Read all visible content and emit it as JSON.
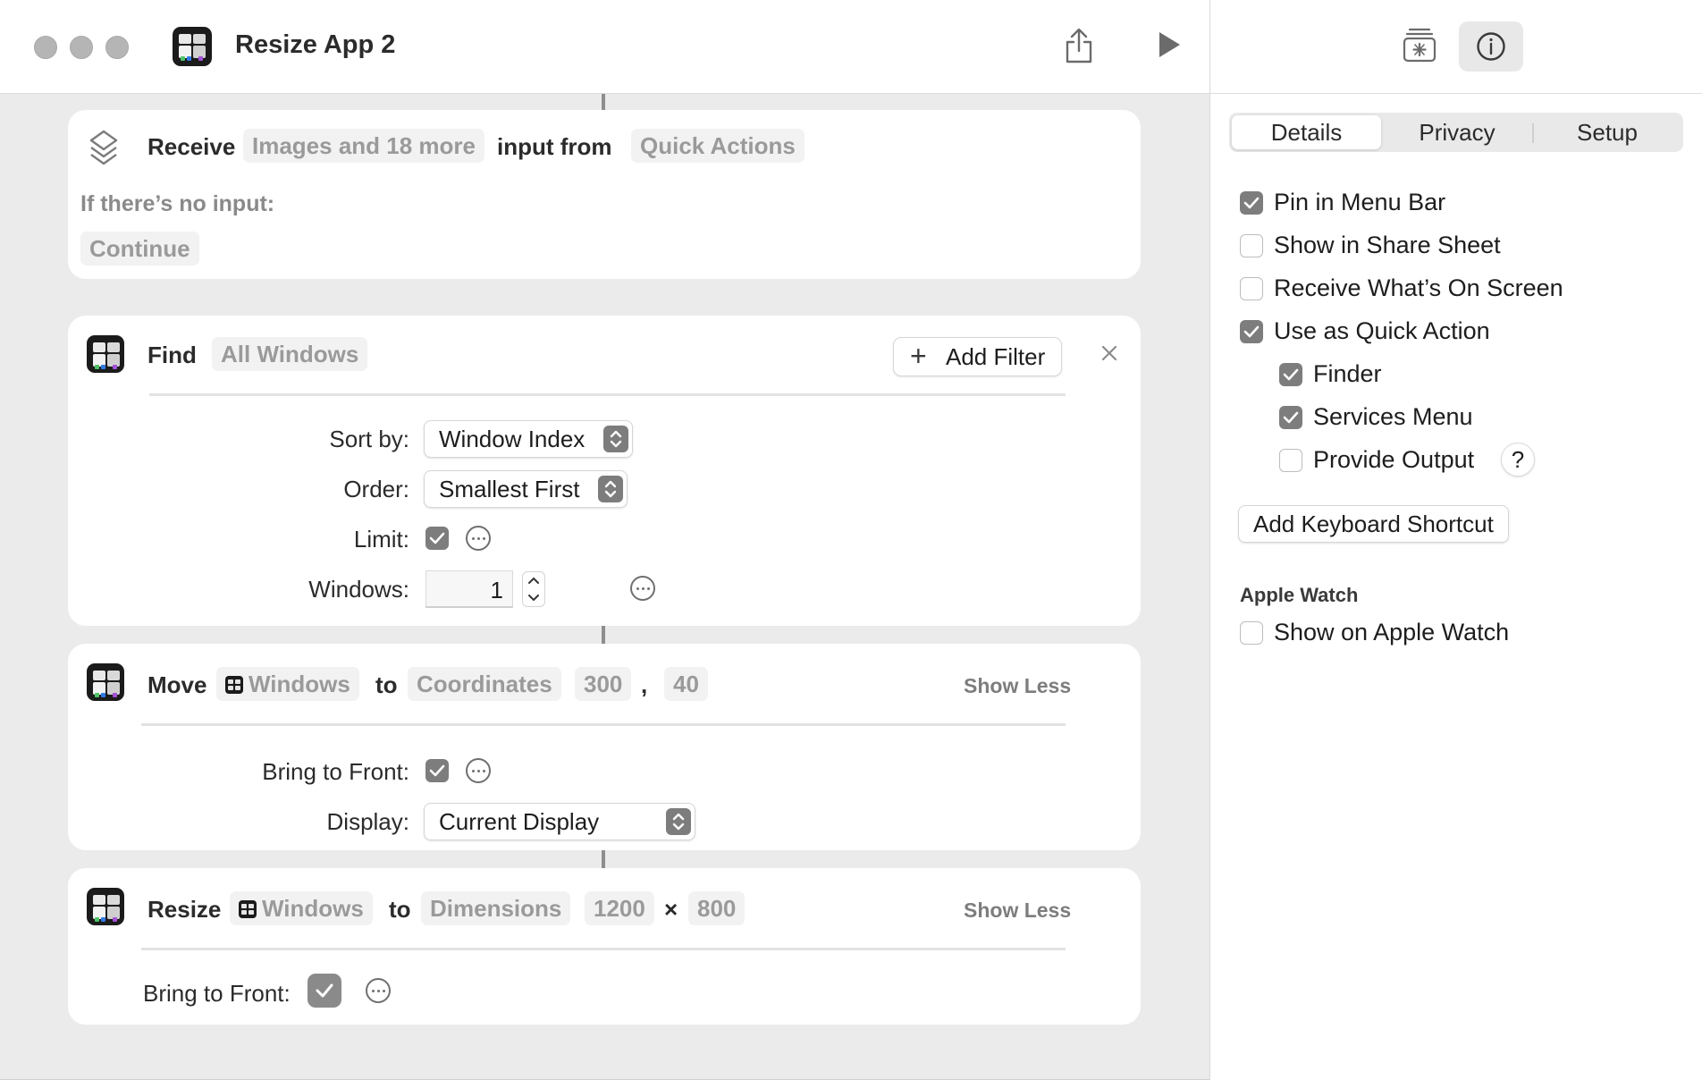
{
  "window": {
    "title": "Resize App 2"
  },
  "actions": {
    "receive": {
      "verb": "Receive",
      "input_types": "Images and 18 more",
      "input_from_label": "input from",
      "source": "Quick Actions",
      "no_input_label": "If there’s no input:",
      "no_input_action": "Continue"
    },
    "find": {
      "verb": "Find",
      "target": "All Windows",
      "add_filter_label": "Add Filter",
      "sort_by_label": "Sort by:",
      "sort_by_value": "Window Index",
      "order_label": "Order:",
      "order_value": "Smallest First",
      "limit_label": "Limit:",
      "limit_checked": true,
      "windows_label": "Windows:",
      "windows_value": "1"
    },
    "move": {
      "verb": "Move",
      "target": "Windows",
      "to_label": "to",
      "mode": "Coordinates",
      "x": "300",
      "comma": ",",
      "y": "40",
      "show_less": "Show Less",
      "bring_to_front_label": "Bring to Front:",
      "bring_to_front_checked": true,
      "display_label": "Display:",
      "display_value": "Current Display"
    },
    "resize": {
      "verb": "Resize",
      "target": "Windows",
      "to_label": "to",
      "mode": "Dimensions",
      "width": "1200",
      "times": "×",
      "height": "800",
      "show_less": "Show Less",
      "bring_to_front_label": "Bring to Front:",
      "bring_to_front_checked": true
    }
  },
  "sidebar": {
    "tabs": [
      "Details",
      "Privacy",
      "Setup"
    ],
    "active_tab": "Details",
    "options": [
      {
        "label": "Pin in Menu Bar",
        "checked": true
      },
      {
        "label": "Show in Share Sheet",
        "checked": false
      },
      {
        "label": "Receive What’s On Screen",
        "checked": false
      },
      {
        "label": "Use as Quick Action",
        "checked": true
      }
    ],
    "quick_action_sub_options": [
      {
        "label": "Finder",
        "checked": true
      },
      {
        "label": "Services Menu",
        "checked": true
      },
      {
        "label": "Provide Output",
        "checked": false
      }
    ],
    "help_label": "?",
    "keyboard_shortcut_label": "Add Keyboard Shortcut",
    "apple_watch_heading": "Apple Watch",
    "apple_watch_option": {
      "label": "Show on Apple Watch",
      "checked": false
    }
  },
  "colors": {
    "canvas_bg": "#ebebeb",
    "card_bg": "#ffffff",
    "token_bg": "#f2f2f2",
    "token_text": "#9a9a9a",
    "checkbox_fill": "#7d7d7d"
  }
}
